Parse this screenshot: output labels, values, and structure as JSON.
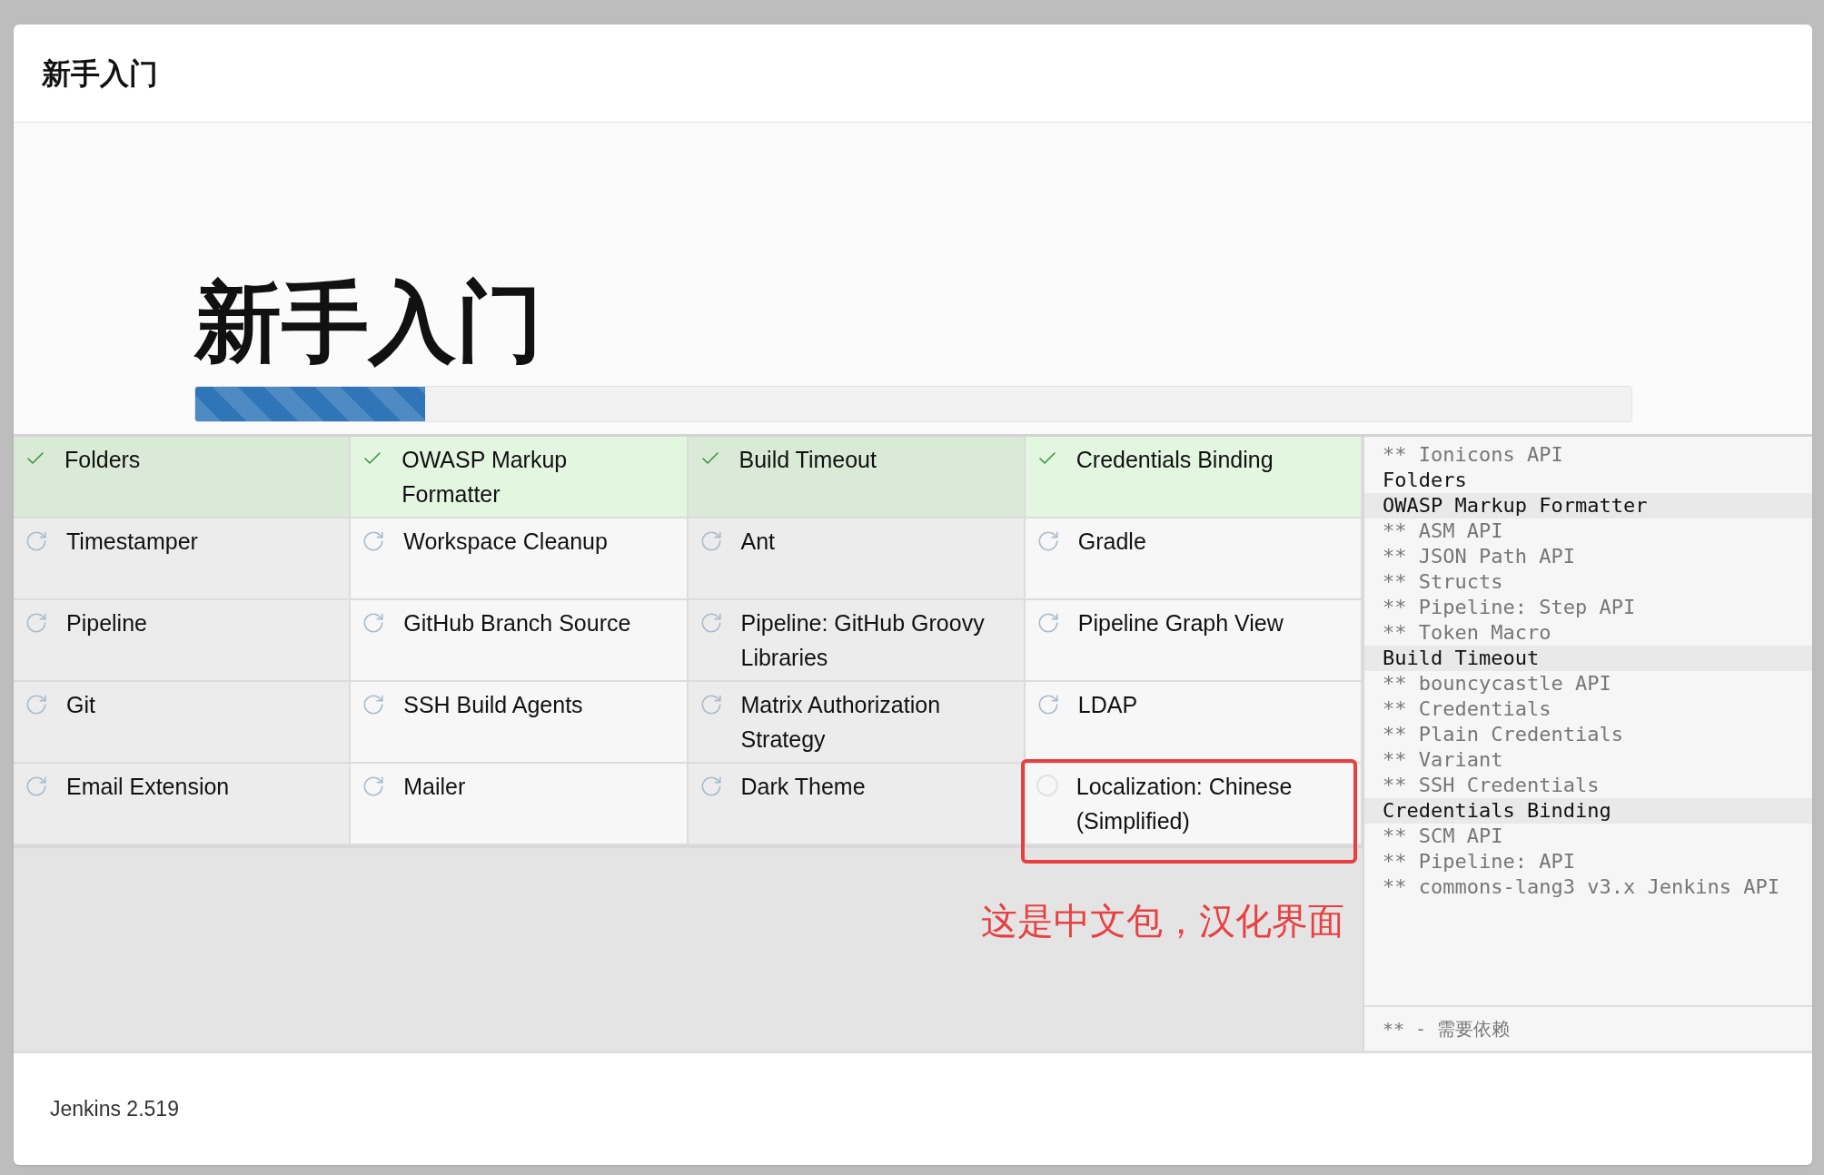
{
  "window": {
    "title": "新手入门"
  },
  "hero": {
    "title": "新手入门",
    "progress": {
      "level": 0.16
    }
  },
  "plugins": [
    {
      "name": "Folders",
      "kind": "done",
      "annotated": false
    },
    {
      "name": "OWASP Markup Formatter",
      "kind": "done",
      "annotated": false
    },
    {
      "name": "Build Timeout",
      "kind": "done",
      "annotated": false
    },
    {
      "name": "Credentials Binding",
      "kind": "done",
      "annotated": false
    },
    {
      "name": "Timestamper",
      "kind": "pending",
      "annotated": false
    },
    {
      "name": "Workspace Cleanup",
      "kind": "pending",
      "annotated": false
    },
    {
      "name": "Ant",
      "kind": "pending",
      "annotated": false
    },
    {
      "name": "Gradle",
      "kind": "pending",
      "annotated": false
    },
    {
      "name": "Pipeline",
      "kind": "pending",
      "annotated": false
    },
    {
      "name": "GitHub Branch Source",
      "kind": "pending",
      "annotated": false
    },
    {
      "name": "Pipeline: GitHub Groovy Libraries",
      "kind": "pending",
      "annotated": false
    },
    {
      "name": "Pipeline Graph View",
      "kind": "pending",
      "annotated": false
    },
    {
      "name": "Git",
      "kind": "pending",
      "annotated": false
    },
    {
      "name": "SSH Build Agents",
      "kind": "pending",
      "annotated": false
    },
    {
      "name": "Matrix Authorization Strategy",
      "kind": "pending",
      "annotated": false
    },
    {
      "name": "LDAP",
      "kind": "pending",
      "annotated": false
    },
    {
      "name": "Email Extension",
      "kind": "pending",
      "annotated": false
    },
    {
      "name": "Mailer",
      "kind": "pending",
      "annotated": false
    },
    {
      "name": "Dark Theme",
      "kind": "pending",
      "annotated": false
    },
    {
      "name": "Localization: Chinese (Simplified)",
      "kind": "waiting",
      "annotated": true
    }
  ],
  "annotation": {
    "text": "这是中文包，汉化界面"
  },
  "log": [
    {
      "kind": "dependency",
      "text": "** Ionicons API"
    },
    {
      "kind": "plugin",
      "text": "Folders",
      "highlighted": false
    },
    {
      "kind": "plugin",
      "text": "OWASP Markup Formatter",
      "highlighted": true
    },
    {
      "kind": "dependency",
      "text": "** ASM API"
    },
    {
      "kind": "dependency",
      "text": "** JSON Path API"
    },
    {
      "kind": "dependency",
      "text": "** Structs"
    },
    {
      "kind": "dependency",
      "text": "** Pipeline: Step API"
    },
    {
      "kind": "dependency",
      "text": "** Token Macro"
    },
    {
      "kind": "plugin",
      "text": "Build Timeout",
      "highlighted": true
    },
    {
      "kind": "dependency",
      "text": "** bouncycastle API"
    },
    {
      "kind": "dependency",
      "text": "** Credentials"
    },
    {
      "kind": "dependency",
      "text": "** Plain Credentials"
    },
    {
      "kind": "dependency",
      "text": "** Variant"
    },
    {
      "kind": "dependency",
      "text": "** SSH Credentials"
    },
    {
      "kind": "plugin",
      "text": "Credentials Binding",
      "highlighted": true
    },
    {
      "kind": "dependency",
      "text": "** SCM API"
    },
    {
      "kind": "dependency",
      "text": "** Pipeline: API"
    },
    {
      "kind": "dependency",
      "text": "** commons-lang3 v3.x Jenkins API"
    }
  ],
  "legend": "** - 需要依赖",
  "footer": {
    "version": "Jenkins 2.519"
  }
}
